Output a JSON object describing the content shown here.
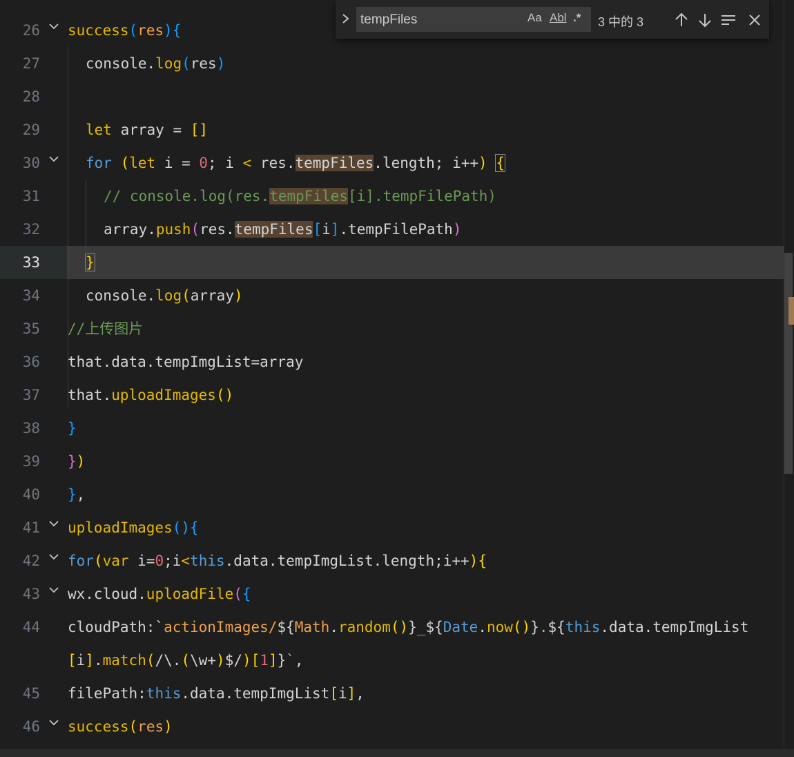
{
  "find_widget": {
    "query": "tempFiles",
    "match_case_label": "Aa",
    "whole_word_label": "Abl",
    "regex_label": ".*",
    "result_count": "3 中的 3"
  },
  "lines": [
    {
      "n": "26",
      "fold": true,
      "indent": 0,
      "tokens": [
        [
          "t-fn2",
          "success"
        ],
        [
          "t-p3",
          "("
        ],
        [
          "t-org",
          "res"
        ],
        [
          "t-p3",
          "){"
        ]
      ]
    },
    {
      "n": "27",
      "indent": 1,
      "tokens": [
        [
          "t-var",
          "console."
        ],
        [
          "t-fn2",
          "log"
        ],
        [
          "t-p3",
          "("
        ],
        [
          "t-var",
          "res"
        ],
        [
          "t-p3",
          ")"
        ]
      ]
    },
    {
      "n": "28",
      "indent": 1,
      "tokens": []
    },
    {
      "n": "29",
      "indent": 1,
      "tokens": [
        [
          "t-fn2",
          "let "
        ],
        [
          "t-var",
          "array "
        ],
        [
          "t-var",
          "= "
        ],
        [
          "t-p1",
          "[]"
        ]
      ]
    },
    {
      "n": "30",
      "fold": true,
      "indent": 1,
      "tokens": [
        [
          "t-kw",
          "for "
        ],
        [
          "t-p1",
          "("
        ],
        [
          "t-fn2",
          "let "
        ],
        [
          "t-var",
          "i = "
        ],
        [
          "t-num",
          "0"
        ],
        [
          "t-var",
          "; i "
        ],
        [
          "t-fn2",
          "<"
        ],
        [
          "t-var",
          " res."
        ],
        [
          "hl",
          "tempFiles"
        ],
        [
          "t-var",
          ".length; i++"
        ],
        [
          "t-p1",
          ")"
        ],
        [
          "t-var",
          " "
        ],
        [
          "box",
          "{"
        ]
      ]
    },
    {
      "n": "31",
      "indent": 2,
      "tokens": [
        [
          "t-cm",
          "// console.log(res."
        ],
        [
          "hl-cm",
          "tempFiles"
        ],
        [
          "t-cm",
          "[i].tempFilePath)"
        ]
      ]
    },
    {
      "n": "32",
      "indent": 2,
      "tokens": [
        [
          "t-var",
          "array."
        ],
        [
          "t-fn2",
          "push"
        ],
        [
          "t-p2",
          "("
        ],
        [
          "t-var",
          "res."
        ],
        [
          "hl",
          "tempFiles"
        ],
        [
          "t-p3",
          "["
        ],
        [
          "t-var",
          "i"
        ],
        [
          "t-p3",
          "]"
        ],
        [
          "t-var",
          ".tempFilePath"
        ],
        [
          "t-p2",
          ")"
        ]
      ]
    },
    {
      "n": "33",
      "indent": 1,
      "current": true,
      "tokens": [
        [
          "box",
          "}"
        ]
      ]
    },
    {
      "n": "34",
      "indent": 1,
      "tokens": [
        [
          "t-var",
          "console."
        ],
        [
          "t-fn2",
          "log"
        ],
        [
          "t-p1",
          "("
        ],
        [
          "t-var",
          "array"
        ],
        [
          "t-p1",
          ")"
        ]
      ]
    },
    {
      "n": "35",
      "indent": 0,
      "tokens": [
        [
          "t-cm",
          "//上传图片"
        ]
      ]
    },
    {
      "n": "36",
      "indent": 0,
      "tokens": [
        [
          "t-var",
          "that.data.tempImgList=array"
        ]
      ]
    },
    {
      "n": "37",
      "indent": 0,
      "tokens": [
        [
          "t-var",
          "that."
        ],
        [
          "t-fn2",
          "uploadImages"
        ],
        [
          "t-p1",
          "()"
        ]
      ]
    },
    {
      "n": "38",
      "indent": 0,
      "tokens": [
        [
          "t-p3",
          "}"
        ]
      ]
    },
    {
      "n": "39",
      "indent": 0,
      "tokens": [
        [
          "t-p2",
          "}"
        ],
        [
          "t-p1",
          ")"
        ]
      ]
    },
    {
      "n": "40",
      "indent": 0,
      "tokens": [
        [
          "t-p3",
          "}"
        ],
        [
          "t-var",
          ","
        ]
      ]
    },
    {
      "n": "41",
      "fold": true,
      "indent": 0,
      "tokens": [
        [
          "t-fn2",
          "uploadImages"
        ],
        [
          "t-p3",
          "(){"
        ]
      ]
    },
    {
      "n": "42",
      "fold": true,
      "indent": 0,
      "tokens": [
        [
          "t-kw",
          "for"
        ],
        [
          "t-p1",
          "("
        ],
        [
          "t-fn2",
          "var "
        ],
        [
          "t-var",
          "i="
        ],
        [
          "t-num",
          "0"
        ],
        [
          "t-var",
          ";i"
        ],
        [
          "t-fn2",
          "<"
        ],
        [
          "t-kw",
          "this"
        ],
        [
          "t-var",
          ".data.tempImgList.length;i++"
        ],
        [
          "t-p1",
          ")"
        ],
        [
          "t-p1",
          "{"
        ]
      ]
    },
    {
      "n": "43",
      "fold": true,
      "indent": 0,
      "tokens": [
        [
          "t-var",
          "wx.cloud."
        ],
        [
          "t-fn2",
          "uploadFile"
        ],
        [
          "t-p2",
          "("
        ],
        [
          "t-p3",
          "{"
        ]
      ]
    },
    {
      "n": "44",
      "indent": 0,
      "tokens": [
        [
          "t-var",
          "cloudPath:`"
        ],
        [
          "t-org",
          "actionImages/"
        ],
        [
          "t-var",
          "${"
        ],
        [
          "t-org",
          "Math"
        ],
        [
          "t-var",
          "."
        ],
        [
          "t-fn2",
          "random"
        ],
        [
          "t-p1",
          "()"
        ],
        [
          "t-var",
          "}"
        ],
        [
          "t-org",
          "_"
        ],
        [
          "t-var",
          "${"
        ],
        [
          "t-kw",
          "Date"
        ],
        [
          "t-var",
          "."
        ],
        [
          "t-fn2",
          "now"
        ],
        [
          "t-p1",
          "()"
        ],
        [
          "t-var",
          "}"
        ],
        [
          "t-org",
          "."
        ],
        [
          "t-var",
          "${"
        ],
        [
          "t-kw",
          "this"
        ],
        [
          "t-var",
          ".data.tempImgList"
        ]
      ]
    },
    {
      "n": "",
      "indent": 0,
      "tokens": [
        [
          "t-p1",
          "["
        ],
        [
          "t-var",
          "i"
        ],
        [
          "t-p1",
          "]"
        ],
        [
          "t-var",
          "."
        ],
        [
          "t-fn2",
          "match"
        ],
        [
          "t-p1",
          "("
        ],
        [
          "t-var",
          "/\\."
        ],
        [
          "t-p1",
          "("
        ],
        [
          "t-var",
          "\\w+"
        ],
        [
          "t-p1",
          ")"
        ],
        [
          "t-var",
          "$/"
        ],
        [
          "t-p1",
          ")"
        ],
        [
          "t-p1",
          "["
        ],
        [
          "t-num",
          "1"
        ],
        [
          "t-p1",
          "]"
        ],
        [
          "t-var",
          "}"
        ],
        [
          "t-org",
          "`"
        ],
        [
          "t-var",
          ","
        ]
      ]
    },
    {
      "n": "45",
      "indent": 0,
      "tokens": [
        [
          "t-var",
          "filePath:"
        ],
        [
          "t-kw",
          "this"
        ],
        [
          "t-var",
          ".data.tempImgList"
        ],
        [
          "t-p1",
          "["
        ],
        [
          "t-var",
          "i"
        ],
        [
          "t-p1",
          "]"
        ],
        [
          "t-var",
          ","
        ]
      ]
    },
    {
      "n": "46",
      "fold": true,
      "indent": 0,
      "tokens": [
        [
          "t-fn2",
          "success"
        ],
        [
          "t-p1",
          "("
        ],
        [
          "t-org",
          "res"
        ],
        [
          "t-p1",
          ")"
        ]
      ]
    }
  ]
}
